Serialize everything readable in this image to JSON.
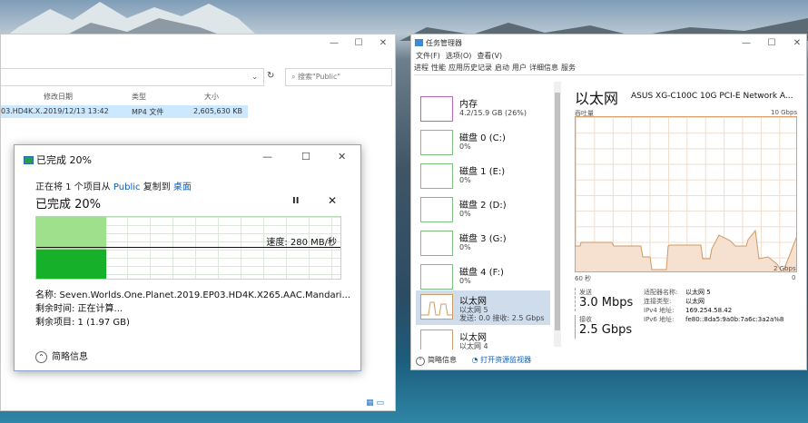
{
  "explorer": {
    "search_placeholder": "搜索\"Public\"",
    "columns": [
      "修改日期",
      "类型",
      "大小"
    ],
    "selected_file": {
      "name": "03.HD4K.X...",
      "date": "2019/12/13 13:42",
      "type": "MP4 文件",
      "size": "2,605,630 KB"
    }
  },
  "copy_dialog": {
    "title": "已完成 20%",
    "line1_prefix": "正在将 1 个项目从 ",
    "source": "Public",
    "line1_mid": " 复制到 ",
    "destination": "桌面",
    "percent_label": "已完成 20%",
    "progress": 0.23,
    "speed_label": "速度: 280 MB/秒",
    "name_line": "名称: Seven.Worlds.One.Planet.2019.EP03.HD4K.X265.AAC.Mandari...",
    "time_left": "剩余时间: 正在计算...",
    "items_left": "剩余项目: 1 (1.97 GB)",
    "fewer_details": "简略信息"
  },
  "taskmgr": {
    "title": "任务管理器",
    "menu": [
      "文件(F)",
      "选项(O)",
      "查看(V)"
    ],
    "tabs": [
      "进程",
      "性能",
      "应用历史记录",
      "启动",
      "用户",
      "详细信息",
      "服务"
    ],
    "side_items": [
      {
        "name": "内存",
        "sub": "4.2/15.9 GB (26%)"
      },
      {
        "name": "磁盘 0 (C:)",
        "sub": "0%"
      },
      {
        "name": "磁盘 1 (E:)",
        "sub": "0%"
      },
      {
        "name": "磁盘 2 (D:)",
        "sub": "0%"
      },
      {
        "name": "磁盘 3 (G:)",
        "sub": "0%"
      },
      {
        "name": "磁盘 4 (F:)",
        "sub": "0%"
      },
      {
        "name": "以太网",
        "sub": "以太网 5",
        "sub2": "发送: 0.0 接收: 2.5 Gbps"
      },
      {
        "name": "以太网",
        "sub": "以太网 4"
      }
    ],
    "heading": "以太网",
    "adapter": "ASUS XG-C100C 10G PCI-E Network A...",
    "chart": {
      "label_throughput": "吞吐量",
      "label_max": "10 Gbps",
      "label_mid": "2 Gbps",
      "label_time": "60 秒",
      "label_zero": "0"
    },
    "send_label": "发送",
    "send_value": "3.0 Mbps",
    "recv_label": "接收",
    "recv_value": "2.5 Gbps",
    "details": [
      {
        "k": "适配器名称:",
        "v": "以太网 5"
      },
      {
        "k": "连接类型:",
        "v": "以太网"
      },
      {
        "k": "IPv4 地址:",
        "v": "169.254.58.42"
      },
      {
        "k": "IPv6 地址:",
        "v": "fe80::8da5:9a0b:7a6c:3a2a%8"
      }
    ],
    "fewer_details": "简略信息",
    "open_monitor": "打开资源监视器"
  },
  "colors": {
    "accent_link": "#0a5fb8",
    "progress_green": "#17b02a",
    "ethernet_orange": "#d09a64"
  }
}
